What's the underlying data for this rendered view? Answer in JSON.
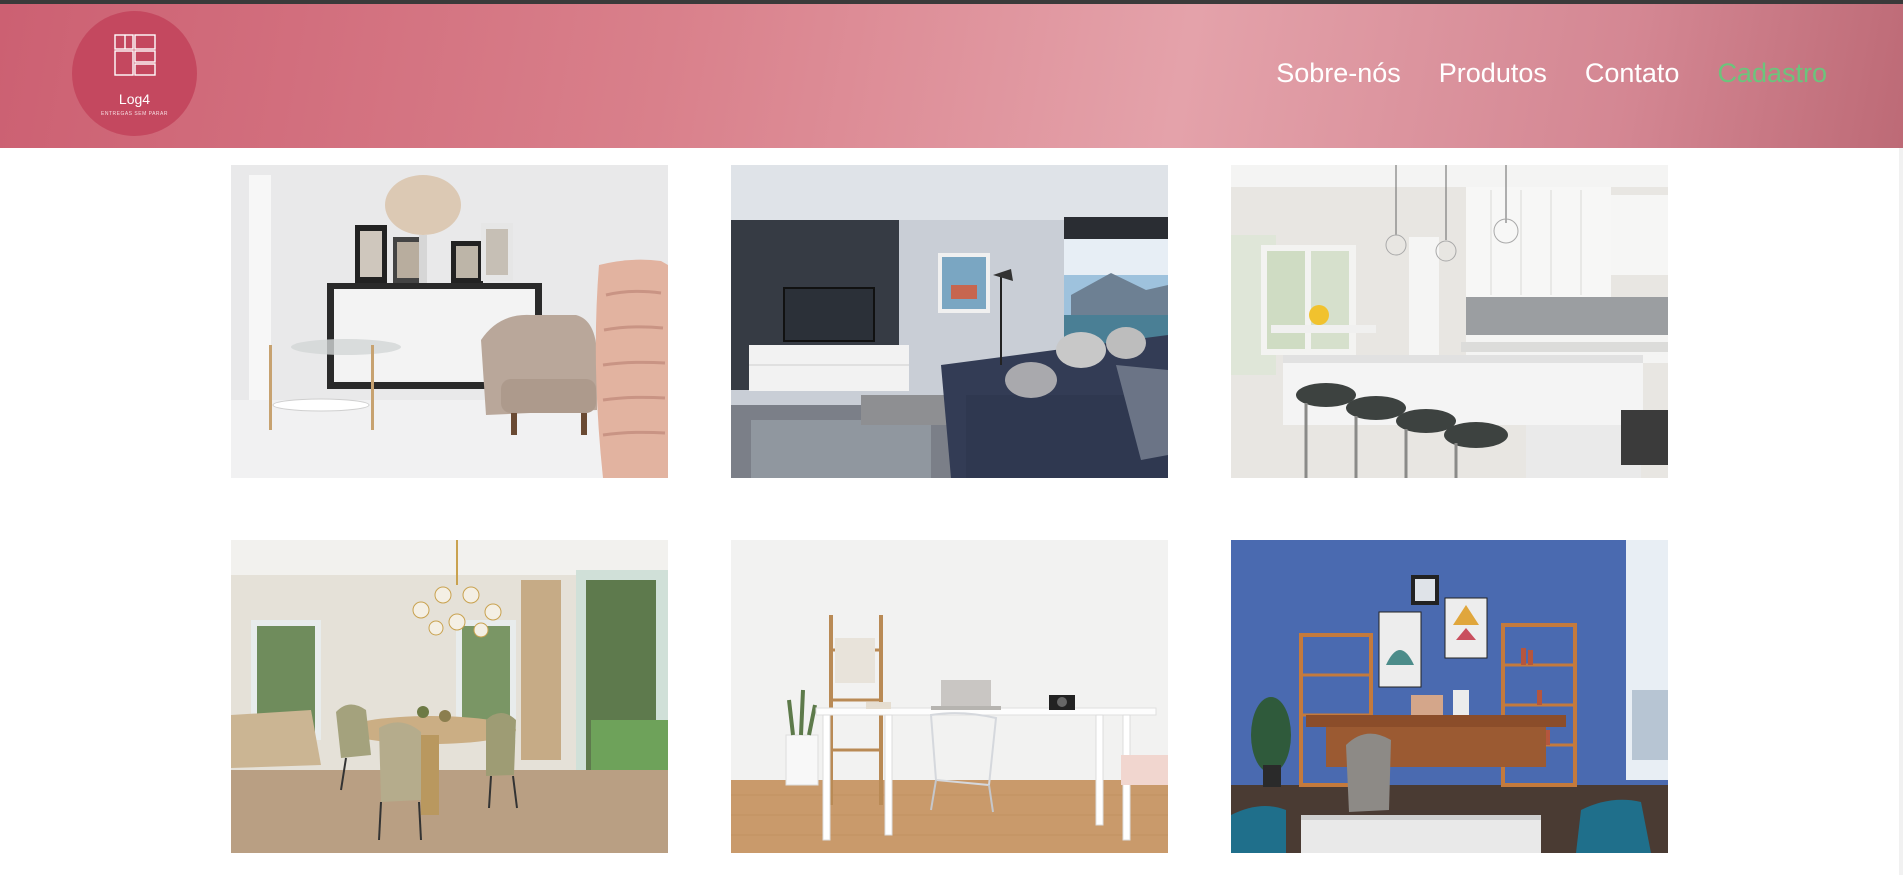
{
  "brand": {
    "name": "Log4",
    "tagline": "ENTREGAS SEM PARAR",
    "color": "#c4485f"
  },
  "nav": {
    "items": [
      "Sobre-nós",
      "Produtos",
      "Contato",
      "Cadastro"
    ],
    "active": "Cadastro",
    "active_color": "#6cc47c"
  },
  "gallery": {
    "images": [
      {
        "icon": "living-room-sideboard-photo"
      },
      {
        "icon": "living-room-tv-sofa-photo"
      },
      {
        "icon": "white-kitchen-island-photo"
      },
      {
        "icon": "dining-room-chandelier-photo"
      },
      {
        "icon": "minimal-desk-workspace-photo"
      },
      {
        "icon": "blue-wall-office-photo"
      }
    ]
  }
}
